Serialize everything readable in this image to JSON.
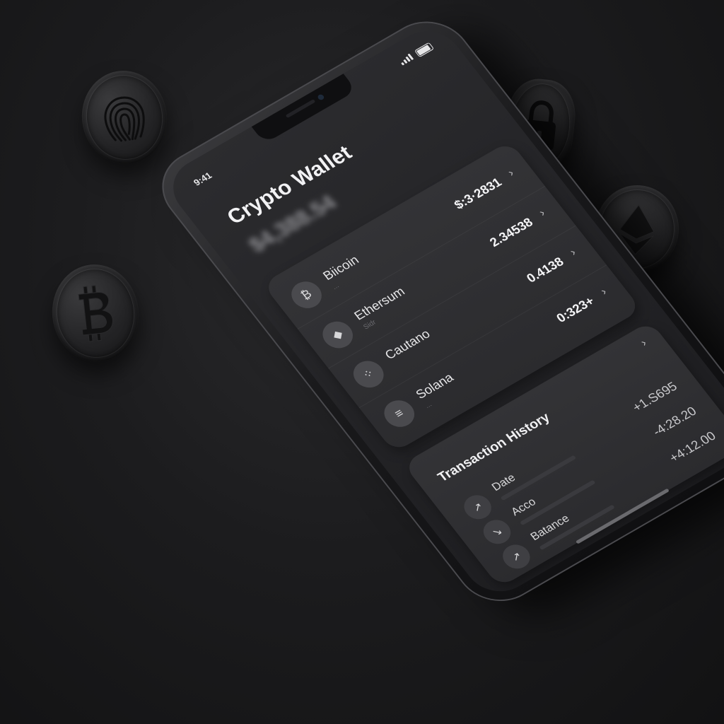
{
  "status_bar": {
    "time": "9:41"
  },
  "wallet": {
    "title": "Crypto Wallet",
    "balance": "$4,388.54"
  },
  "assets": [
    {
      "name": "Biicoin",
      "sub": "...",
      "value": "$:3·2831",
      "icon": "bitcoin-symbol-icon"
    },
    {
      "name": "Ethersum",
      "sub": "Sidr",
      "value": "2.34538",
      "icon": "ethereum-diamond-icon"
    },
    {
      "name": "Cautano",
      "sub": "",
      "value": "0.4138",
      "icon": "cardano-dots-icon"
    },
    {
      "name": "Solana",
      "sub": "...",
      "value": "0:323+",
      "icon": "solana-lines-icon"
    }
  ],
  "transactions": {
    "title": "Transaction History",
    "rows": [
      {
        "label": "Date",
        "amount": "+1.S695",
        "direction": "up"
      },
      {
        "label": "Acco",
        "amount": "-4:28.20",
        "direction": "down"
      },
      {
        "label": "Batance",
        "amount": "+4:12.00",
        "direction": "up"
      }
    ]
  },
  "background_icons": [
    "fingerprint-icon",
    "bitcoin-coin-icon",
    "lock-icon",
    "ethereum-coin-icon"
  ],
  "colors": {
    "background": "#1c1c1e",
    "screen": "#232326",
    "card": "#2f2f32",
    "text": "#f2f2f4"
  }
}
